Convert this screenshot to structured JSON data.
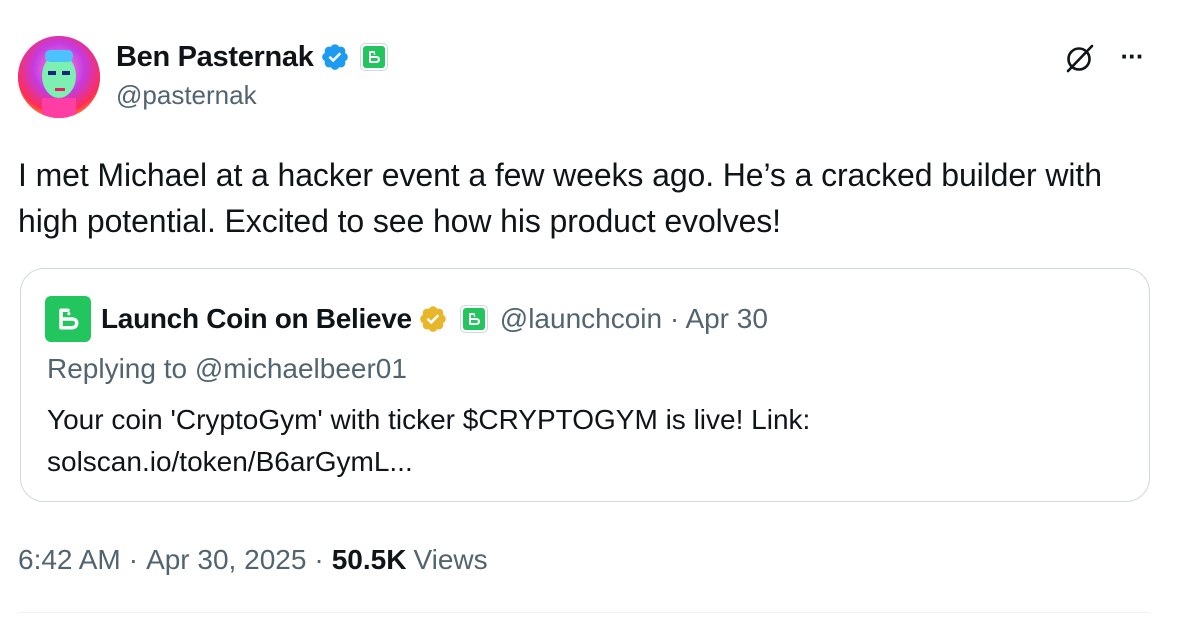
{
  "author": {
    "display_name": "Ben Pasternak",
    "handle": "@pasternak",
    "verified_icon": "blue-verified-badge",
    "affiliation_icon": "believe-app-badge"
  },
  "actions": {
    "grok_icon": "grok-icon",
    "more_label": "···"
  },
  "tweet": {
    "text": "I met Michael at a hacker event a few weeks ago. He’s a cracked builder with high potential. Excited to see how his product evolves!"
  },
  "quote": {
    "display_name": "Launch Coin on Believe",
    "verified_icon": "gold-verified-badge",
    "handle": "@launchcoin",
    "separator": "·",
    "date": "Apr 30",
    "replying_to": "Replying to @michaelbeer01",
    "text": "Your coin 'CryptoGym' with ticker $CRYPTOGYM is live! Link: solscan.io/token/B6arGymL..."
  },
  "meta": {
    "time": "6:42 AM",
    "separator": "·",
    "date": "Apr 30, 2025",
    "views_count": "50.5K",
    "views_label": "Views"
  },
  "colors": {
    "primary_text": "#0f1419",
    "secondary_text": "#536471",
    "border": "#cfd9de",
    "verified_blue": "#1d9bf0",
    "verified_gold": "#e8b62a",
    "believe_green": "#22c55e"
  }
}
